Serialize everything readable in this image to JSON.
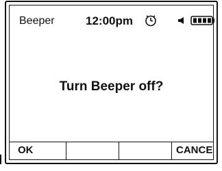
{
  "status_bar": {
    "app_title": "Beeper",
    "time": "12:00pm",
    "icons": [
      "alarm-clock-icon",
      "speaker-icon",
      "battery-full-icon"
    ]
  },
  "dialog": {
    "message": "Turn Beeper off?"
  },
  "softkeys": {
    "left": "OK",
    "middle_left": "",
    "middle_right": "",
    "right": "CANCEL"
  }
}
